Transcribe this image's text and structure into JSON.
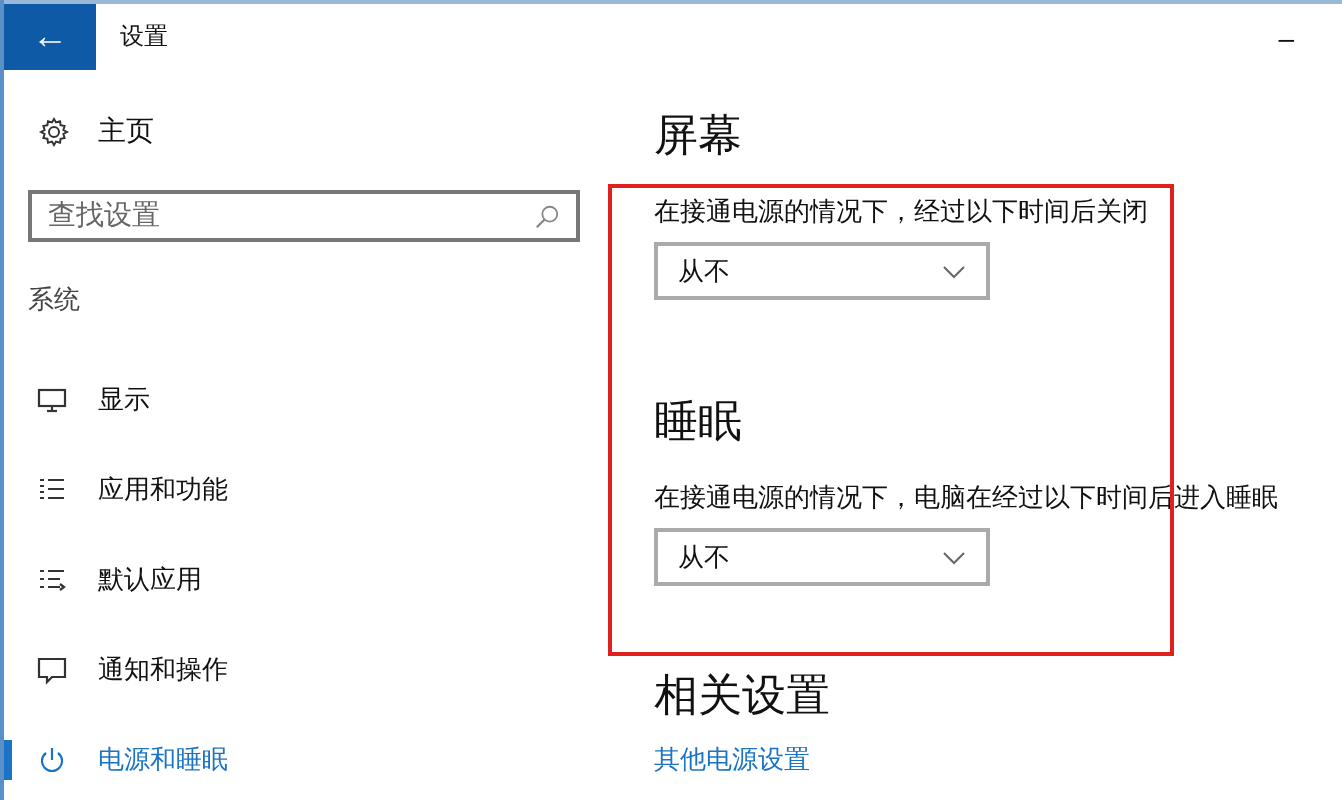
{
  "window": {
    "title": "设置",
    "back_button": "←",
    "minimize": "–"
  },
  "sidebar": {
    "home": "主页",
    "search": {
      "placeholder": "查找设置"
    },
    "group": "系统",
    "items": [
      {
        "label": "显示",
        "kind": "display",
        "selected": false
      },
      {
        "label": "应用和功能",
        "kind": "apps",
        "selected": false
      },
      {
        "label": "默认应用",
        "kind": "defaults",
        "selected": false
      },
      {
        "label": "通知和操作",
        "kind": "notifications",
        "selected": false
      },
      {
        "label": "电源和睡眠",
        "kind": "power",
        "selected": true
      }
    ]
  },
  "sections": [
    {
      "heading": "屏幕",
      "description": "在接通电源的情况下，经过以下时间后关闭",
      "dropdown": "从不"
    },
    {
      "heading": "睡眠",
      "description": "在接通电源的情况下，电脑在经过以下时间后进入睡眠",
      "dropdown": "从不"
    }
  ],
  "related": {
    "heading": "相关设置",
    "link": "其他电源设置"
  }
}
